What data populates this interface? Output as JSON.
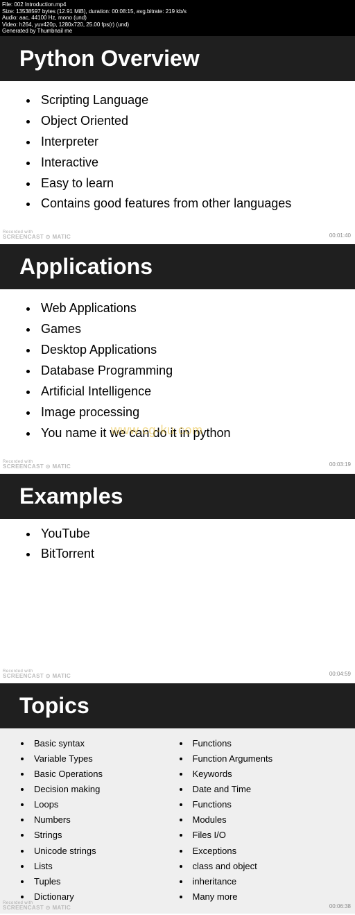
{
  "meta": {
    "file": "File: 002 Introduction.mp4",
    "size": "Size: 13538597 bytes (12.91 MiB), duration: 00:08:15, avg.bitrate: 219 kb/s",
    "audio": "Audio: aac, 44100 Hz, mono (und)",
    "video": "Video: h264, yuv420p, 1280x720, 25.00 fps(r) (und)",
    "gen": "Generated by Thumbnail me"
  },
  "slides": [
    {
      "title": "Python Overview",
      "items": [
        "Scripting Language",
        "Object Oriented",
        "Interpreter",
        "Interactive",
        "Easy to learn",
        "Contains good features from other languages"
      ],
      "timestamp": "00:01:40"
    },
    {
      "title": "Applications",
      "items": [
        "Web Applications",
        "Games",
        "Desktop Applications",
        "Database Programming",
        "Artificial Intelligence",
        "Image processing",
        "You name it we can do it in python"
      ],
      "timestamp": "00:03:19",
      "url_stamp": "www.cg-ku.com"
    },
    {
      "title": "Examples",
      "items": [
        "YouTube",
        "BitTorrent"
      ],
      "timestamp": "00:04:59"
    },
    {
      "title": "Topics",
      "left": [
        "Basic syntax",
        "Variable Types",
        "Basic Operations",
        "Decision making",
        "Loops",
        "Numbers",
        "Strings",
        "Unicode strings",
        "Lists",
        "Tuples",
        "Dictionary"
      ],
      "right": [
        "Functions",
        "Function Arguments",
        "Keywords",
        "Date and Time",
        "Functions",
        "Modules",
        "Files I/O",
        "Exceptions",
        "class and object",
        "inheritance",
        "Many more"
      ],
      "timestamp": "00:06:38"
    }
  ],
  "watermark": {
    "line1": "Recorded with",
    "line2": "SCREENCAST",
    "line3": "MATIC"
  }
}
